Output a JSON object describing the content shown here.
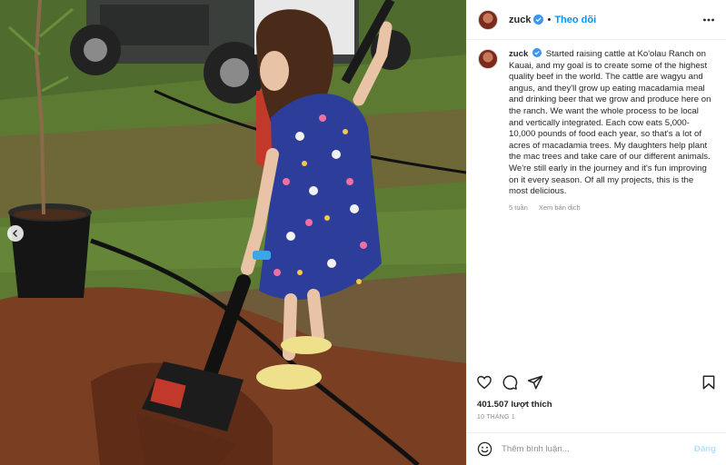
{
  "post": {
    "username": "zuck",
    "dot": "•",
    "follow_label": "Theo dõi",
    "caption_username": "zuck",
    "caption_text": "Started raising cattle at Ko'olau Ranch on Kauai, and my goal is to create some of the highest quality beef in the world. The cattle are wagyu and angus, and they'll grow up eating macadamia meal and drinking beer that we grow and produce here on the ranch. We want the whole process to be local and vertically integrated. Each cow eats 5,000-10,000 pounds of food each year, so that's a lot of acres of macadamia trees. My daughters help plant the mac trees and take care of our different animals. We're still early in the journey and it's fun improving on it every season. Of all my projects, this is the most delicious.",
    "age": "5 tuần",
    "translate_label": "Xem bản dịch",
    "likes": "401.507 lượt thích",
    "date": "10 THÁNG 1",
    "comment_placeholder": "Thêm bình luận...",
    "post_label": "Đăng"
  },
  "icons": {
    "verified": "verified-badge-icon",
    "more": "more-options-icon",
    "like": "heart-icon",
    "comment": "comment-icon",
    "share": "share-icon",
    "save": "bookmark-icon",
    "emoji": "emoji-icon",
    "prev": "chevron-left-icon"
  },
  "colors": {
    "accent": "#0095f6",
    "verified": "#3897f0",
    "muted": "#8e8e8e"
  }
}
